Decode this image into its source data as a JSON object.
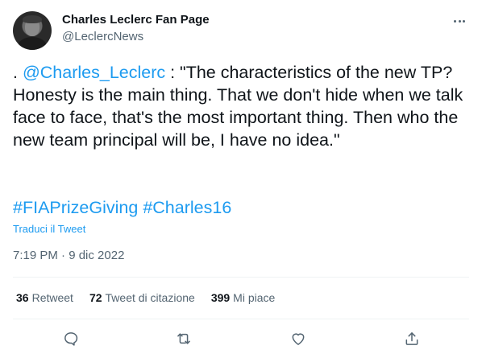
{
  "author": {
    "name": "Charles Leclerc Fan Page",
    "handle": "@LeclercNews"
  },
  "tweet": {
    "prefix": ". ",
    "mention": "@Charles_Leclerc",
    "body": " : \"The characteristics of the new TP? Honesty is the main thing. That we don't hide when we talk face to face, that's the most important thing. Then who the new team principal will be, I have no idea.\"",
    "hashtags": [
      "#FIAPrizeGiving",
      "#Charles16"
    ],
    "translate_label": "Traduci il Tweet",
    "timestamp": "7:19 PM · 9 dic 2022"
  },
  "stats": {
    "retweets_count": "36",
    "retweets_label": "Retweet",
    "quotes_count": "72",
    "quotes_label": "Tweet di citazione",
    "likes_count": "399",
    "likes_label": "Mi piace"
  },
  "icons": {
    "more": "more-icon",
    "reply": "reply-icon",
    "retweet": "retweet-icon",
    "like": "heart-icon",
    "share": "share-icon"
  },
  "colors": {
    "accent": "#1d9bf0",
    "text": "#0f1419",
    "secondary": "#536471",
    "divider": "#eff3f4"
  }
}
